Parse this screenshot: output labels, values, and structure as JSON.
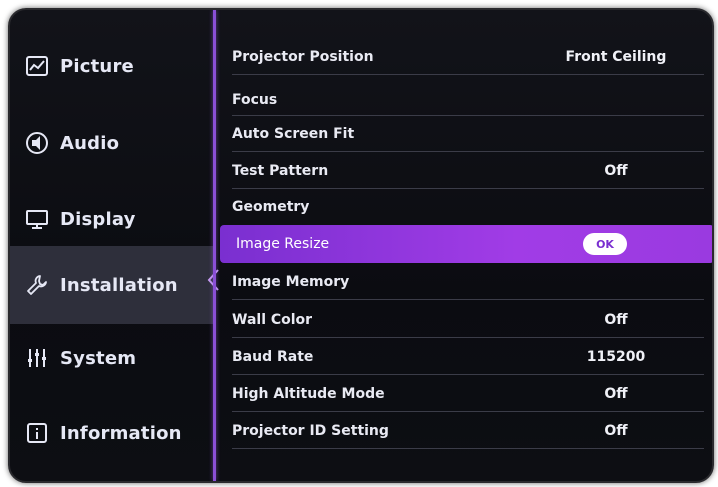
{
  "sidebar": {
    "items": [
      {
        "label": "Picture",
        "icon": "picture-icon"
      },
      {
        "label": "Audio",
        "icon": "speaker-icon"
      },
      {
        "label": "Display",
        "icon": "monitor-icon"
      },
      {
        "label": "Installation",
        "icon": "wrench-icon"
      },
      {
        "label": "System",
        "icon": "sliders-icon"
      },
      {
        "label": "Information",
        "icon": "info-icon"
      }
    ],
    "active_index": 3
  },
  "menu": {
    "rows": [
      {
        "label": "Projector Position",
        "value": "Front Ceiling"
      },
      {
        "label": "Focus",
        "value": ""
      },
      {
        "label": "Auto Screen Fit",
        "value": ""
      },
      {
        "label": "Test Pattern",
        "value": "Off"
      },
      {
        "label": "Geometry",
        "value": ""
      },
      {
        "label": "Image Resize",
        "value": "OK"
      },
      {
        "label": "Image Memory",
        "value": ""
      },
      {
        "label": "Wall Color",
        "value": "Off"
      },
      {
        "label": "Baud Rate",
        "value": "115200"
      },
      {
        "label": "High Altitude Mode",
        "value": "Off"
      },
      {
        "label": "Projector ID Setting",
        "value": "Off"
      }
    ],
    "selected_index": 5
  },
  "colors": {
    "accent": "#9a3ae0",
    "divider": "#8a4fd6",
    "background": "#0e0f14",
    "active_sidebar": "#2e2f3b"
  }
}
